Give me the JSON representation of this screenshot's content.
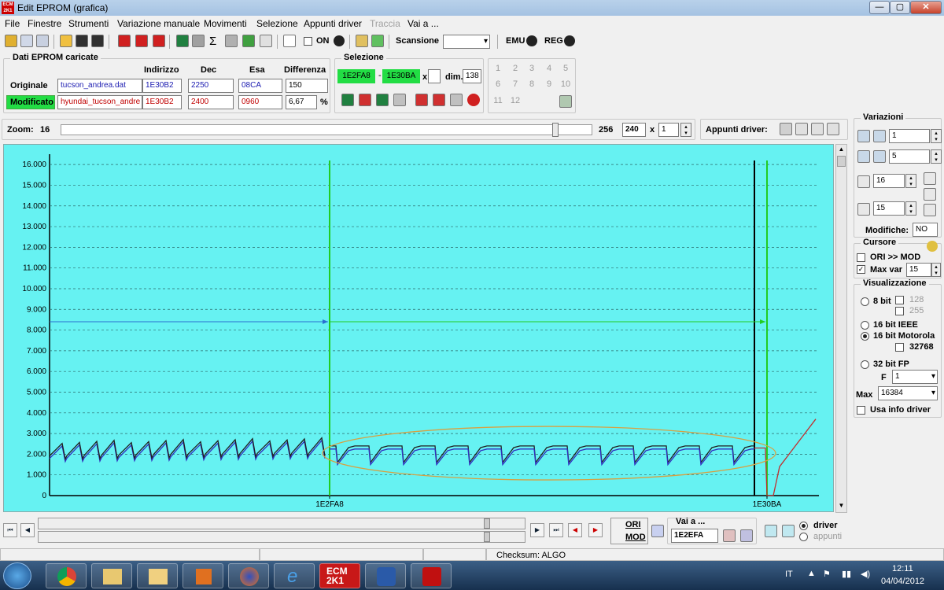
{
  "window": {
    "title": "Edit EPROM (grafica)",
    "app_icon_text": "ECM 2K1"
  },
  "menu": [
    "File",
    "Finestre",
    "Strumenti",
    "Variazione manuale",
    "Movimenti",
    "Selezione",
    "Appunti driver",
    "Traccia",
    "Vai a ..."
  ],
  "toolbar": {
    "on_label": "ON",
    "scansione_label": "Scansione",
    "emu_label": "EMU",
    "reg_label": "REG"
  },
  "dati_eprom": {
    "title": "Dati EPROM caricate",
    "headers": {
      "indirizzo": "Indirizzo",
      "dec": "Dec",
      "esa": "Esa",
      "differenza": "Differenza"
    },
    "originale": {
      "label": "Originale",
      "file": "tucson_andrea.dat",
      "indirizzo": "1E30B2",
      "dec": "2250",
      "esa": "08CA",
      "differenza": "150"
    },
    "modificato": {
      "label": "Modificato",
      "file": "hyundai_tucson_andre",
      "indirizzo": "1E30B2",
      "dec": "2400",
      "esa": "0960",
      "differenza": "6,67",
      "unit": "%"
    }
  },
  "selezione": {
    "title": "Selezione",
    "start": "1E2FA8",
    "dash": "-",
    "end": "1E30BA",
    "x": "x",
    "dim_label": "dim.",
    "dim": "138"
  },
  "number_grid": [
    "1",
    "2",
    "3",
    "4",
    "5",
    "6",
    "7",
    "8",
    "9",
    "10",
    "11",
    "12"
  ],
  "zoom": {
    "label": "Zoom:",
    "min": "16",
    "max": "256",
    "value": "240",
    "x": "x",
    "mult": "1",
    "appunti_label": "Appunti driver:"
  },
  "variazioni": {
    "title": "Variazioni",
    "v1": "1",
    "v2": "5",
    "a": "16",
    "p": "15",
    "modifiche_label": "Modifiche:",
    "modifiche": "NO"
  },
  "cursore": {
    "title": "Cursore",
    "ori_mod": "ORI >> MOD",
    "max_var_label": "Max var",
    "max_var": "15"
  },
  "visualizzazione": {
    "title": "Visualizzazione",
    "opt_8bit": "8 bit",
    "opt_128": "128",
    "opt_255": "255",
    "opt_16ieee": "16 bit IEEE",
    "opt_16motorola": "16 bit Motorola",
    "opt_32768": "32768",
    "opt_32fp": "32 bit FP",
    "f_label": "F",
    "f_value": "1",
    "max_label": "Max",
    "max_value": "16384",
    "usa_info": "Usa info driver"
  },
  "chart_data": {
    "type": "line",
    "y_ticks": [
      "16.000",
      "15.000",
      "14.000",
      "13.000",
      "12.000",
      "11.000",
      "10.000",
      "9.000",
      "8.000",
      "7.000",
      "6.000",
      "5.000",
      "4.000",
      "3.000",
      "2.000",
      "1.000",
      "0"
    ],
    "ylim": [
      0,
      16500
    ],
    "x_labels": [
      "1E2FA8",
      "1E30BA"
    ],
    "background": "#66f2f2",
    "series_colors": {
      "original": "#3030c0",
      "modified": "#202020",
      "tail": "#c03030",
      "cursor_green": "#22cc22",
      "selection_ellipse": "#d8a040"
    }
  },
  "nav": {
    "ori_label": "ORI",
    "mod_label": "MOD",
    "vai_label": "Vai a ...",
    "vai_value": "1E2EFA",
    "driver_label": "driver",
    "appunti_label": "appunti"
  },
  "status": {
    "checksum": "Checksum: ALGO"
  },
  "taskbar": {
    "lang": "IT",
    "time": "12:11",
    "date": "04/04/2012"
  }
}
